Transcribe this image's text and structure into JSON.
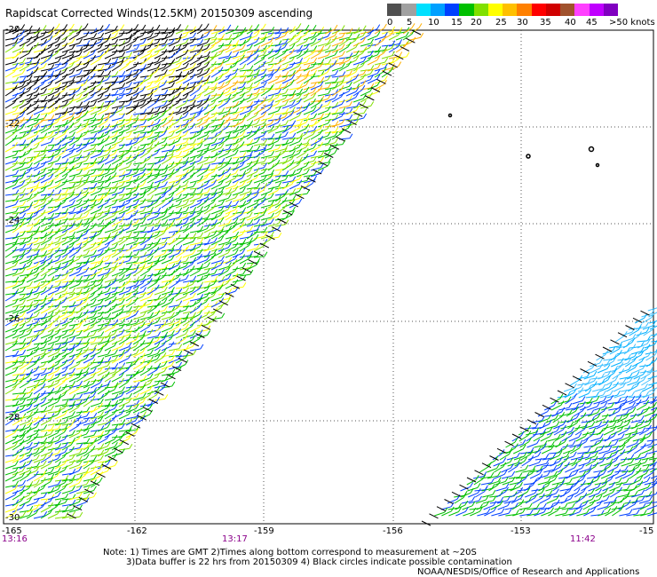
{
  "title": "Rapidscat Corrected Winds(12.5KM) 20150309 ascending",
  "colorbar": {
    "labels": [
      "0",
      "5",
      "10",
      "15",
      "20",
      "25",
      "30",
      "35",
      "40",
      "45",
      ">50 knots"
    ],
    "colors": [
      "#505050",
      "#a0a0a0",
      "#00e0ff",
      "#00a0ff",
      "#0040ff",
      "#00c000",
      "#80e000",
      "#ffff00",
      "#ffc000",
      "#ff8000",
      "#ff0000",
      "#d00000",
      "#a0522d",
      "#ff40ff",
      "#c000ff",
      "#8000c0"
    ]
  },
  "lat_labels": [
    "-20",
    "-22",
    "-24",
    "-26",
    "-28",
    "-30"
  ],
  "lon_labels": [
    "-165",
    "-162",
    "-159",
    "-156",
    "-153",
    "-15"
  ],
  "time_labels": [
    "13:16",
    "13:17",
    "11:42"
  ],
  "notes": [
    "Note: 1) Times are GMT 2)Times along bottom correspond to measurement at ~20S",
    "3)Data buffer is 22 hrs from 20150309 4) Black circles indicate possible contamination",
    "NOAA/NESDIS/Office of Research and Applications"
  ]
}
